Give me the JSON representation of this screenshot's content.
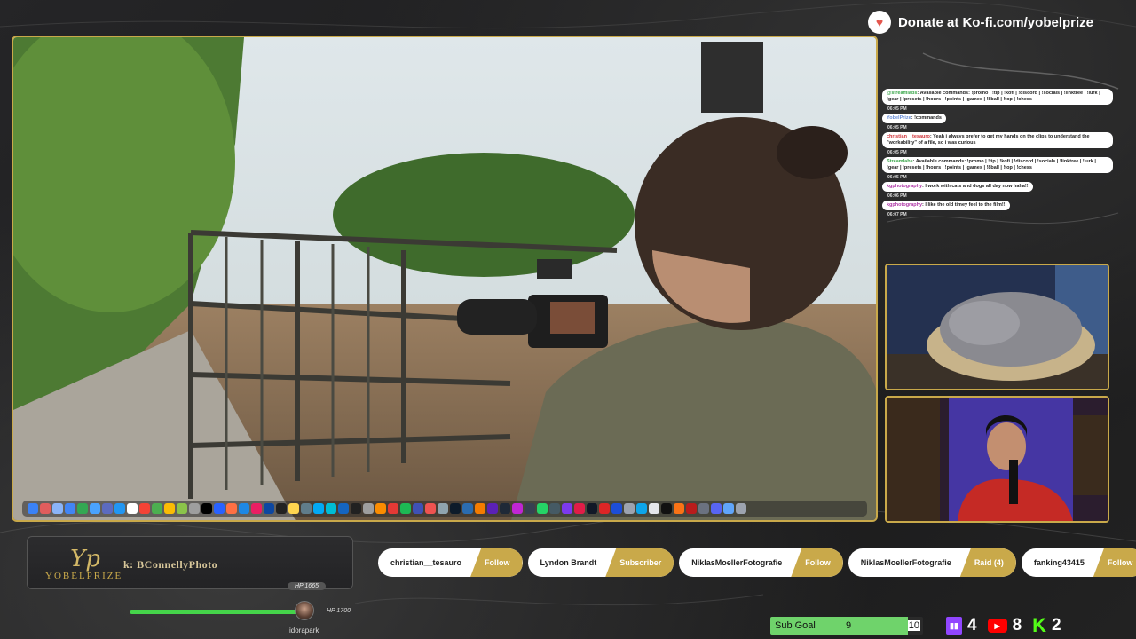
{
  "header": {
    "donate_text": "Donate at Ko-fi.com/yobelprize",
    "kofi_icon": "kofi-heart-icon"
  },
  "chat": {
    "messages": [
      {
        "user": "@streamlabs",
        "user_color": "#3aa64a",
        "text": ": Available commands: !promo | !tip | !kofi | !discord | !socials | !linktree | !lurk | !gear | !presets | !hours | !points | !games | !8ball | !top | !chess",
        "time": "06:05 PM"
      },
      {
        "user": "YobelPrize",
        "user_color": "#6a8fd8",
        "text": ": !commands",
        "time": "06:05 PM"
      },
      {
        "user": "christian__tesauro",
        "user_color": "#d0343a",
        "text": ": Yeah i always prefer to get my hands on the clips to understand the \"workability\" of a file, so i was curious",
        "time": "06:05 PM"
      },
      {
        "user": "Streamlabs",
        "user_color": "#3aa64a",
        "text": ": Available commands: !promo | !tip | !kofi | !discord | !socials | !linktree | !lurk | !gear | !presets | !hours | !points | !games | !8ball | !top | !chess",
        "time": "06:05 PM"
      },
      {
        "user": "kgphotography",
        "user_color": "#b03aa8",
        "text": ": I work with cats and dogs all day now haha!!",
        "time": "06:06 PM"
      },
      {
        "user": "kgphotography",
        "user_color": "#b03aa8",
        "text": ": I like the old timey feel to the film!!",
        "time": "06:07 PM"
      }
    ]
  },
  "branding": {
    "logo_text": "YOBELPRIZE",
    "ticker": "k: BConnellyPhoto"
  },
  "events": [
    {
      "name": "christian__tesauro",
      "type": "Follow"
    },
    {
      "name": "Lyndon Brandt",
      "type": "Subscriber"
    },
    {
      "name": "NiklasMoellerFotografie",
      "type": "Follow"
    },
    {
      "name": "NiklasMoellerFotografie",
      "type": "Raid (4)"
    },
    {
      "name": "fanking43415",
      "type": "Follow"
    }
  ],
  "hp": {
    "top_label": "HP 1665",
    "right_label": "HP 1700",
    "username": "idorapark",
    "fill_fraction": 0.98,
    "bar_color": "#45d44a"
  },
  "subgoal": {
    "label": "Sub Goal",
    "current": "9",
    "max": "10",
    "fraction": 0.9
  },
  "counters": {
    "twitch": "4",
    "youtube": "8",
    "kick": "2",
    "twitch_icon": "twitch-icon",
    "youtube_icon": "youtube-icon",
    "kick_icon": "kick-icon"
  },
  "dock_colors": [
    "#3b82f6",
    "#e05d5d",
    "#8ab4f8",
    "#4285f4",
    "#34a853",
    "#4aa3ff",
    "#5c6bc0",
    "#2196f3",
    "#ffffff",
    "#f44336",
    "#4caf50",
    "#fbbc04",
    "#8bc34a",
    "#9e9e9e",
    "#000000",
    "#2962ff",
    "#ff7043",
    "#1e88e5",
    "#e91e63",
    "#0d47a1",
    "#222222",
    "#ffd54f",
    "#607d8b",
    "#03a9f4",
    "#00bcd4",
    "#1565c0",
    "#212121",
    "#9e9e9e",
    "#fb8c00",
    "#e53935",
    "#1db954",
    "#3f51b5",
    "#ef5350",
    "#90a4ae",
    "#0d1b2a",
    "#2b6cb0",
    "#f57c00",
    "#5b21b6",
    "#1f2937",
    "#c026d3",
    "#374151",
    "#25d366",
    "#455a64",
    "#7c3aed",
    "#e11d48",
    "#111827",
    "#dc2626",
    "#1d4ed8",
    "#9ca3af",
    "#0ea5e9",
    "#e5e7eb",
    "#111111",
    "#f97316",
    "#b91c1c",
    "#6b7280",
    "#5865f2",
    "#60a5fa",
    "#9ca3af"
  ]
}
